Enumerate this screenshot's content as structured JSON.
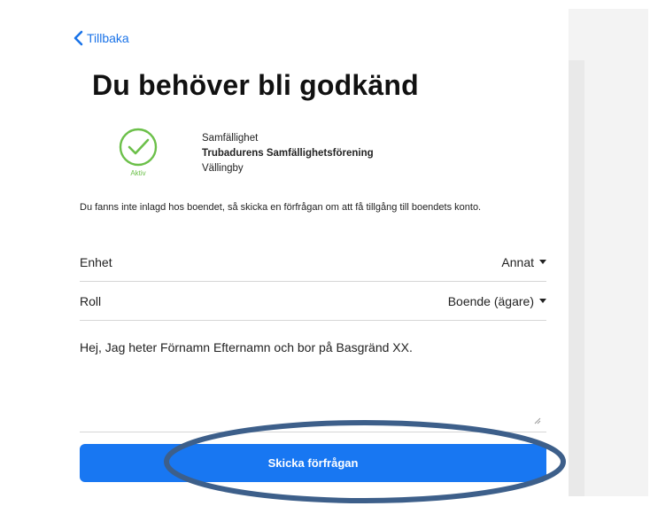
{
  "header": {
    "back_label": "Tillbaka",
    "title": "Du behöver bli godkänd"
  },
  "organization": {
    "status_label": "Aktiv",
    "type": "Samfällighet",
    "name": "Trubadurens Samfällighetsförening",
    "location": "Vällingby"
  },
  "info_text": "Du fanns inte inlagd hos boendet, så skicka en förfrågan om att få tillgång till boendets konto.",
  "form": {
    "unit_label": "Enhet",
    "unit_value": "Annat",
    "role_label": "Roll",
    "role_value": "Boende (ägare)",
    "message": "Hej, Jag heter Förnamn Efternamn och bor på Basgränd XX.",
    "submit_label": "Skicka förfrågan"
  },
  "colors": {
    "accent": "#1877f2",
    "link": "#1a73e8",
    "status_green": "#6cc04a",
    "highlight_outline": "#3d5f8a"
  },
  "icons": {
    "back": "chevron-left-icon",
    "status": "check-circle-icon",
    "dropdown": "caret-down-icon",
    "resize": "resize-grip-icon"
  }
}
